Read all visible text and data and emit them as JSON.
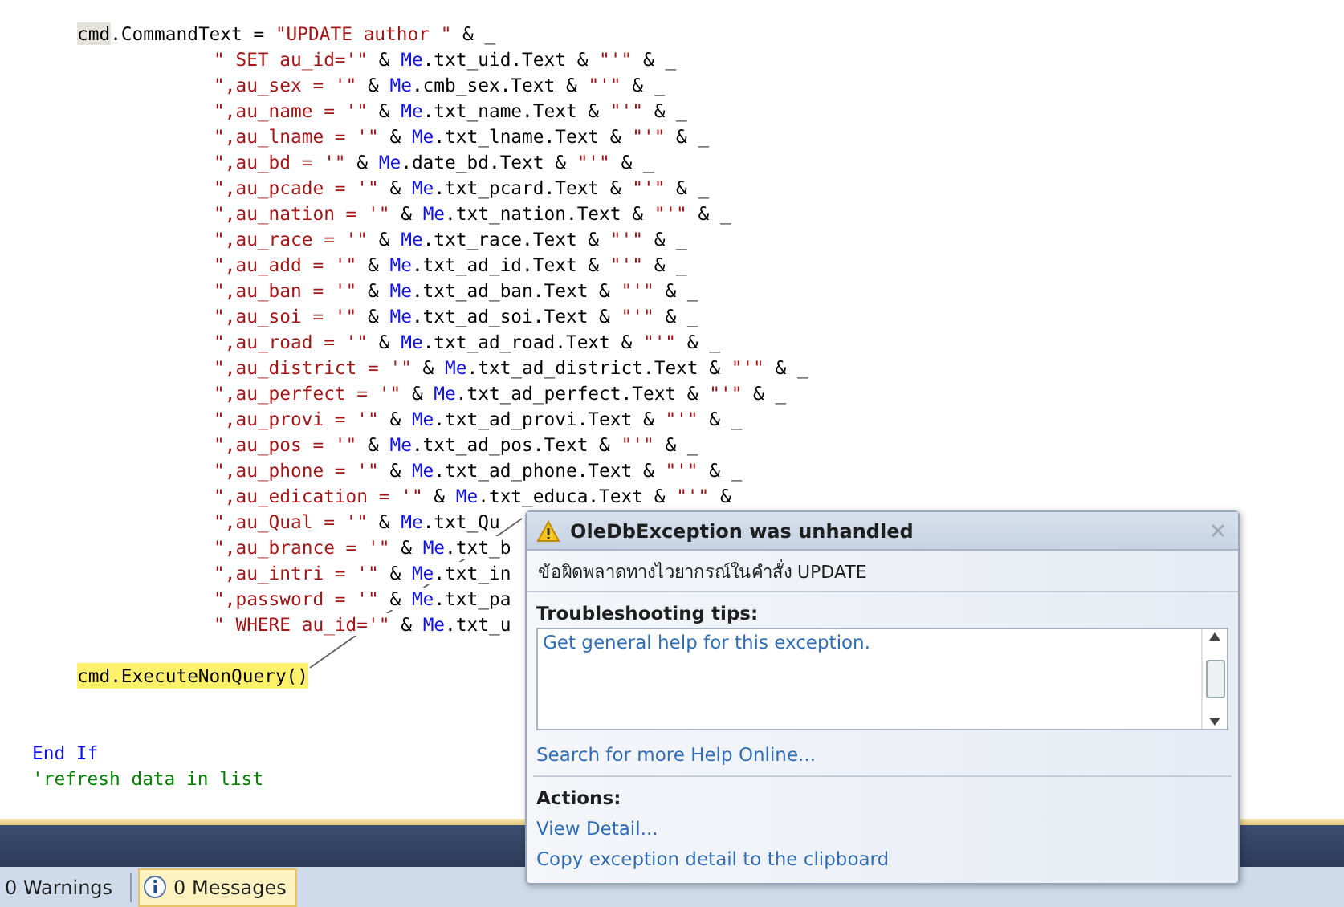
{
  "code": {
    "lines": [
      {
        "kind": "statement",
        "current": false,
        "segments": [
          {
            "kind": "highlight",
            "text": "cmd"
          },
          {
            "kind": "plain",
            "text": ".CommandText = "
          },
          {
            "kind": "string",
            "text": "\"UPDATE author \""
          },
          {
            "kind": "plain",
            "text": " & _"
          }
        ]
      },
      {
        "kind": "continuation",
        "current": false,
        "segments": [
          {
            "kind": "string",
            "text": "\" SET au_id='\""
          },
          {
            "kind": "plain",
            "text": " & "
          },
          {
            "kind": "keyword",
            "text": "Me"
          },
          {
            "kind": "plain",
            "text": ".txt_uid.Text & "
          },
          {
            "kind": "string",
            "text": "\"'\""
          },
          {
            "kind": "plain",
            "text": " & _"
          }
        ]
      },
      {
        "kind": "continuation",
        "current": false,
        "segments": [
          {
            "kind": "string",
            "text": "\",au_sex = '\""
          },
          {
            "kind": "plain",
            "text": " & "
          },
          {
            "kind": "keyword",
            "text": "Me"
          },
          {
            "kind": "plain",
            "text": ".cmb_sex.Text & "
          },
          {
            "kind": "string",
            "text": "\"'\""
          },
          {
            "kind": "plain",
            "text": " & _"
          }
        ]
      },
      {
        "kind": "continuation",
        "current": false,
        "segments": [
          {
            "kind": "string",
            "text": "\",au_name = '\""
          },
          {
            "kind": "plain",
            "text": " & "
          },
          {
            "kind": "keyword",
            "text": "Me"
          },
          {
            "kind": "plain",
            "text": ".txt_name.Text & "
          },
          {
            "kind": "string",
            "text": "\"'\""
          },
          {
            "kind": "plain",
            "text": " & _"
          }
        ]
      },
      {
        "kind": "continuation",
        "current": false,
        "segments": [
          {
            "kind": "string",
            "text": "\",au_lname = '\""
          },
          {
            "kind": "plain",
            "text": " & "
          },
          {
            "kind": "keyword",
            "text": "Me"
          },
          {
            "kind": "plain",
            "text": ".txt_lname.Text & "
          },
          {
            "kind": "string",
            "text": "\"'\""
          },
          {
            "kind": "plain",
            "text": " & _"
          }
        ]
      },
      {
        "kind": "continuation",
        "current": false,
        "segments": [
          {
            "kind": "string",
            "text": "\",au_bd = '\""
          },
          {
            "kind": "plain",
            "text": " & "
          },
          {
            "kind": "keyword",
            "text": "Me"
          },
          {
            "kind": "plain",
            "text": ".date_bd.Text & "
          },
          {
            "kind": "string",
            "text": "\"'\""
          },
          {
            "kind": "plain",
            "text": " & _"
          }
        ]
      },
      {
        "kind": "continuation",
        "current": false,
        "segments": [
          {
            "kind": "string",
            "text": "\",au_pcade = '\""
          },
          {
            "kind": "plain",
            "text": " & "
          },
          {
            "kind": "keyword",
            "text": "Me"
          },
          {
            "kind": "plain",
            "text": ".txt_pcard.Text & "
          },
          {
            "kind": "string",
            "text": "\"'\""
          },
          {
            "kind": "plain",
            "text": " & _"
          }
        ]
      },
      {
        "kind": "continuation",
        "current": false,
        "segments": [
          {
            "kind": "string",
            "text": "\",au_nation = '\""
          },
          {
            "kind": "plain",
            "text": " & "
          },
          {
            "kind": "keyword",
            "text": "Me"
          },
          {
            "kind": "plain",
            "text": ".txt_nation.Text & "
          },
          {
            "kind": "string",
            "text": "\"'\""
          },
          {
            "kind": "plain",
            "text": " & _"
          }
        ]
      },
      {
        "kind": "continuation",
        "current": false,
        "segments": [
          {
            "kind": "string",
            "text": "\",au_race = '\""
          },
          {
            "kind": "plain",
            "text": " & "
          },
          {
            "kind": "keyword",
            "text": "Me"
          },
          {
            "kind": "plain",
            "text": ".txt_race.Text & "
          },
          {
            "kind": "string",
            "text": "\"'\""
          },
          {
            "kind": "plain",
            "text": " & _"
          }
        ]
      },
      {
        "kind": "continuation",
        "current": false,
        "segments": [
          {
            "kind": "string",
            "text": "\",au_add = '\""
          },
          {
            "kind": "plain",
            "text": " & "
          },
          {
            "kind": "keyword",
            "text": "Me"
          },
          {
            "kind": "plain",
            "text": ".txt_ad_id.Text & "
          },
          {
            "kind": "string",
            "text": "\"'\""
          },
          {
            "kind": "plain",
            "text": " & _"
          }
        ]
      },
      {
        "kind": "continuation",
        "current": false,
        "segments": [
          {
            "kind": "string",
            "text": "\",au_ban = '\""
          },
          {
            "kind": "plain",
            "text": " & "
          },
          {
            "kind": "keyword",
            "text": "Me"
          },
          {
            "kind": "plain",
            "text": ".txt_ad_ban.Text & "
          },
          {
            "kind": "string",
            "text": "\"'\""
          },
          {
            "kind": "plain",
            "text": " & _"
          }
        ]
      },
      {
        "kind": "continuation",
        "current": false,
        "segments": [
          {
            "kind": "string",
            "text": "\",au_soi = '\""
          },
          {
            "kind": "plain",
            "text": " & "
          },
          {
            "kind": "keyword",
            "text": "Me"
          },
          {
            "kind": "plain",
            "text": ".txt_ad_soi.Text & "
          },
          {
            "kind": "string",
            "text": "\"'\""
          },
          {
            "kind": "plain",
            "text": " & _"
          }
        ]
      },
      {
        "kind": "continuation",
        "current": false,
        "segments": [
          {
            "kind": "string",
            "text": "\",au_road = '\""
          },
          {
            "kind": "plain",
            "text": " & "
          },
          {
            "kind": "keyword",
            "text": "Me"
          },
          {
            "kind": "plain",
            "text": ".txt_ad_road.Text & "
          },
          {
            "kind": "string",
            "text": "\"'\""
          },
          {
            "kind": "plain",
            "text": " & _"
          }
        ]
      },
      {
        "kind": "continuation",
        "current": false,
        "segments": [
          {
            "kind": "string",
            "text": "\",au_district = '\""
          },
          {
            "kind": "plain",
            "text": " & "
          },
          {
            "kind": "keyword",
            "text": "Me"
          },
          {
            "kind": "plain",
            "text": ".txt_ad_district.Text & "
          },
          {
            "kind": "string",
            "text": "\"'\""
          },
          {
            "kind": "plain",
            "text": " & _"
          }
        ]
      },
      {
        "kind": "continuation",
        "current": false,
        "segments": [
          {
            "kind": "string",
            "text": "\",au_perfect = '\""
          },
          {
            "kind": "plain",
            "text": " & "
          },
          {
            "kind": "keyword",
            "text": "Me"
          },
          {
            "kind": "plain",
            "text": ".txt_ad_perfect.Text & "
          },
          {
            "kind": "string",
            "text": "\"'\""
          },
          {
            "kind": "plain",
            "text": " & _"
          }
        ]
      },
      {
        "kind": "continuation",
        "current": false,
        "segments": [
          {
            "kind": "string",
            "text": "\",au_provi = '\""
          },
          {
            "kind": "plain",
            "text": " & "
          },
          {
            "kind": "keyword",
            "text": "Me"
          },
          {
            "kind": "plain",
            "text": ".txt_ad_provi.Text & "
          },
          {
            "kind": "string",
            "text": "\"'\""
          },
          {
            "kind": "plain",
            "text": " & _"
          }
        ]
      },
      {
        "kind": "continuation",
        "current": false,
        "segments": [
          {
            "kind": "string",
            "text": "\",au_pos = '\""
          },
          {
            "kind": "plain",
            "text": " & "
          },
          {
            "kind": "keyword",
            "text": "Me"
          },
          {
            "kind": "plain",
            "text": ".txt_ad_pos.Text & "
          },
          {
            "kind": "string",
            "text": "\"'\""
          },
          {
            "kind": "plain",
            "text": " & _"
          }
        ]
      },
      {
        "kind": "continuation",
        "current": false,
        "segments": [
          {
            "kind": "string",
            "text": "\",au_phone = '\""
          },
          {
            "kind": "plain",
            "text": " & "
          },
          {
            "kind": "keyword",
            "text": "Me"
          },
          {
            "kind": "plain",
            "text": ".txt_ad_phone.Text & "
          },
          {
            "kind": "string",
            "text": "\"'\""
          },
          {
            "kind": "plain",
            "text": " & _"
          }
        ]
      },
      {
        "kind": "continuation",
        "current": false,
        "segments": [
          {
            "kind": "string",
            "text": "\",au_edication = '\""
          },
          {
            "kind": "plain",
            "text": " & "
          },
          {
            "kind": "keyword",
            "text": "Me"
          },
          {
            "kind": "plain",
            "text": ".txt_educa.Text & "
          },
          {
            "kind": "string",
            "text": "\"'\""
          },
          {
            "kind": "plain",
            "text": " &"
          }
        ]
      },
      {
        "kind": "continuation",
        "current": false,
        "segments": [
          {
            "kind": "string",
            "text": "\",au_Qual = '\""
          },
          {
            "kind": "plain",
            "text": " & "
          },
          {
            "kind": "keyword",
            "text": "Me"
          },
          {
            "kind": "plain",
            "text": ".txt_Qu"
          }
        ]
      },
      {
        "kind": "continuation",
        "current": false,
        "segments": [
          {
            "kind": "string",
            "text": "\",au_brance = '\""
          },
          {
            "kind": "plain",
            "text": " & "
          },
          {
            "kind": "keyword",
            "text": "Me"
          },
          {
            "kind": "plain",
            "text": ".txt_b"
          }
        ]
      },
      {
        "kind": "continuation",
        "current": false,
        "segments": [
          {
            "kind": "string",
            "text": "\",au_intri = '\""
          },
          {
            "kind": "plain",
            "text": " & "
          },
          {
            "kind": "keyword",
            "text": "Me"
          },
          {
            "kind": "plain",
            "text": ".txt_in"
          }
        ]
      },
      {
        "kind": "continuation",
        "current": false,
        "segments": [
          {
            "kind": "string",
            "text": "\",password = '\""
          },
          {
            "kind": "plain",
            "text": " & "
          },
          {
            "kind": "keyword",
            "text": "Me"
          },
          {
            "kind": "plain",
            "text": ".txt_pa"
          }
        ]
      },
      {
        "kind": "continuation",
        "current": false,
        "segments": [
          {
            "kind": "string",
            "text": "\" WHERE au_id='\""
          },
          {
            "kind": "plain",
            "text": " & "
          },
          {
            "kind": "keyword",
            "text": "Me"
          },
          {
            "kind": "plain",
            "text": ".txt_u"
          }
        ]
      },
      {
        "kind": "blank",
        "current": false
      },
      {
        "kind": "statement",
        "current": true,
        "segments": [
          {
            "kind": "plain",
            "text": "cmd.ExecuteNonQuery()"
          }
        ]
      },
      {
        "kind": "blank",
        "current": false
      },
      {
        "kind": "blank",
        "current": false
      },
      {
        "kind": "outer",
        "current": false,
        "segments": [
          {
            "kind": "keyword",
            "text": "End If"
          }
        ]
      },
      {
        "kind": "outer",
        "current": false,
        "segments": [
          {
            "kind": "comment",
            "text": "'refresh data in list"
          }
        ]
      }
    ]
  },
  "exception": {
    "title": "OleDbException was unhandled",
    "message": "ข้อผิดพลาดทางไวยากรณ์ในคำสั่ง UPDATE",
    "tips_heading": "Troubleshooting tips:",
    "tips": [
      "Get general help for this exception."
    ],
    "search_link": "Search for more Help Online...",
    "actions_heading": "Actions:",
    "actions": [
      "View Detail...",
      "Copy exception detail to the clipboard"
    ]
  },
  "status_bar": {
    "tabs": [
      {
        "label": "0 Warnings",
        "kind": "warnings",
        "selected": false
      },
      {
        "label": "0 Messages",
        "kind": "messages",
        "selected": true
      }
    ]
  }
}
